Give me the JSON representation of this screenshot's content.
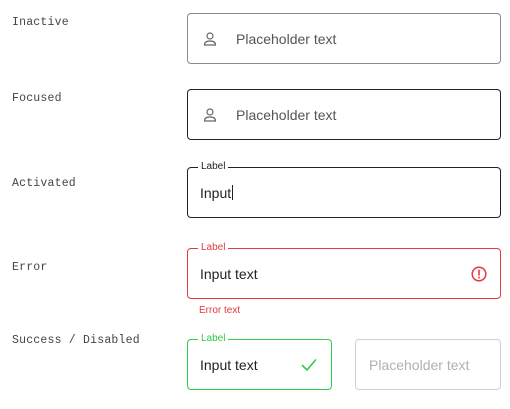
{
  "rows": {
    "inactive": "Inactive",
    "focused": "Focused",
    "activated": "Activated",
    "error": "Error",
    "success_disabled": "Success / Disabled"
  },
  "fields": {
    "inactive": {
      "placeholder": "Placeholder text",
      "icon": "user-icon",
      "border_color": "#8a8a8a"
    },
    "focused": {
      "placeholder": "Placeholder text",
      "icon": "user-icon",
      "border_color": "#222222"
    },
    "activated": {
      "label": "Label",
      "value": "Input",
      "border_color": "#222222"
    },
    "error": {
      "label": "Label",
      "value": "Input text",
      "helper": "Error text",
      "icon": "error-alert-icon",
      "color": "#e5393e"
    },
    "success": {
      "label": "Label",
      "value": "Input text",
      "icon": "check-icon",
      "color": "#2ecc4a"
    },
    "disabled": {
      "placeholder": "Placeholder text",
      "border_color": "#d0d0d0"
    }
  }
}
